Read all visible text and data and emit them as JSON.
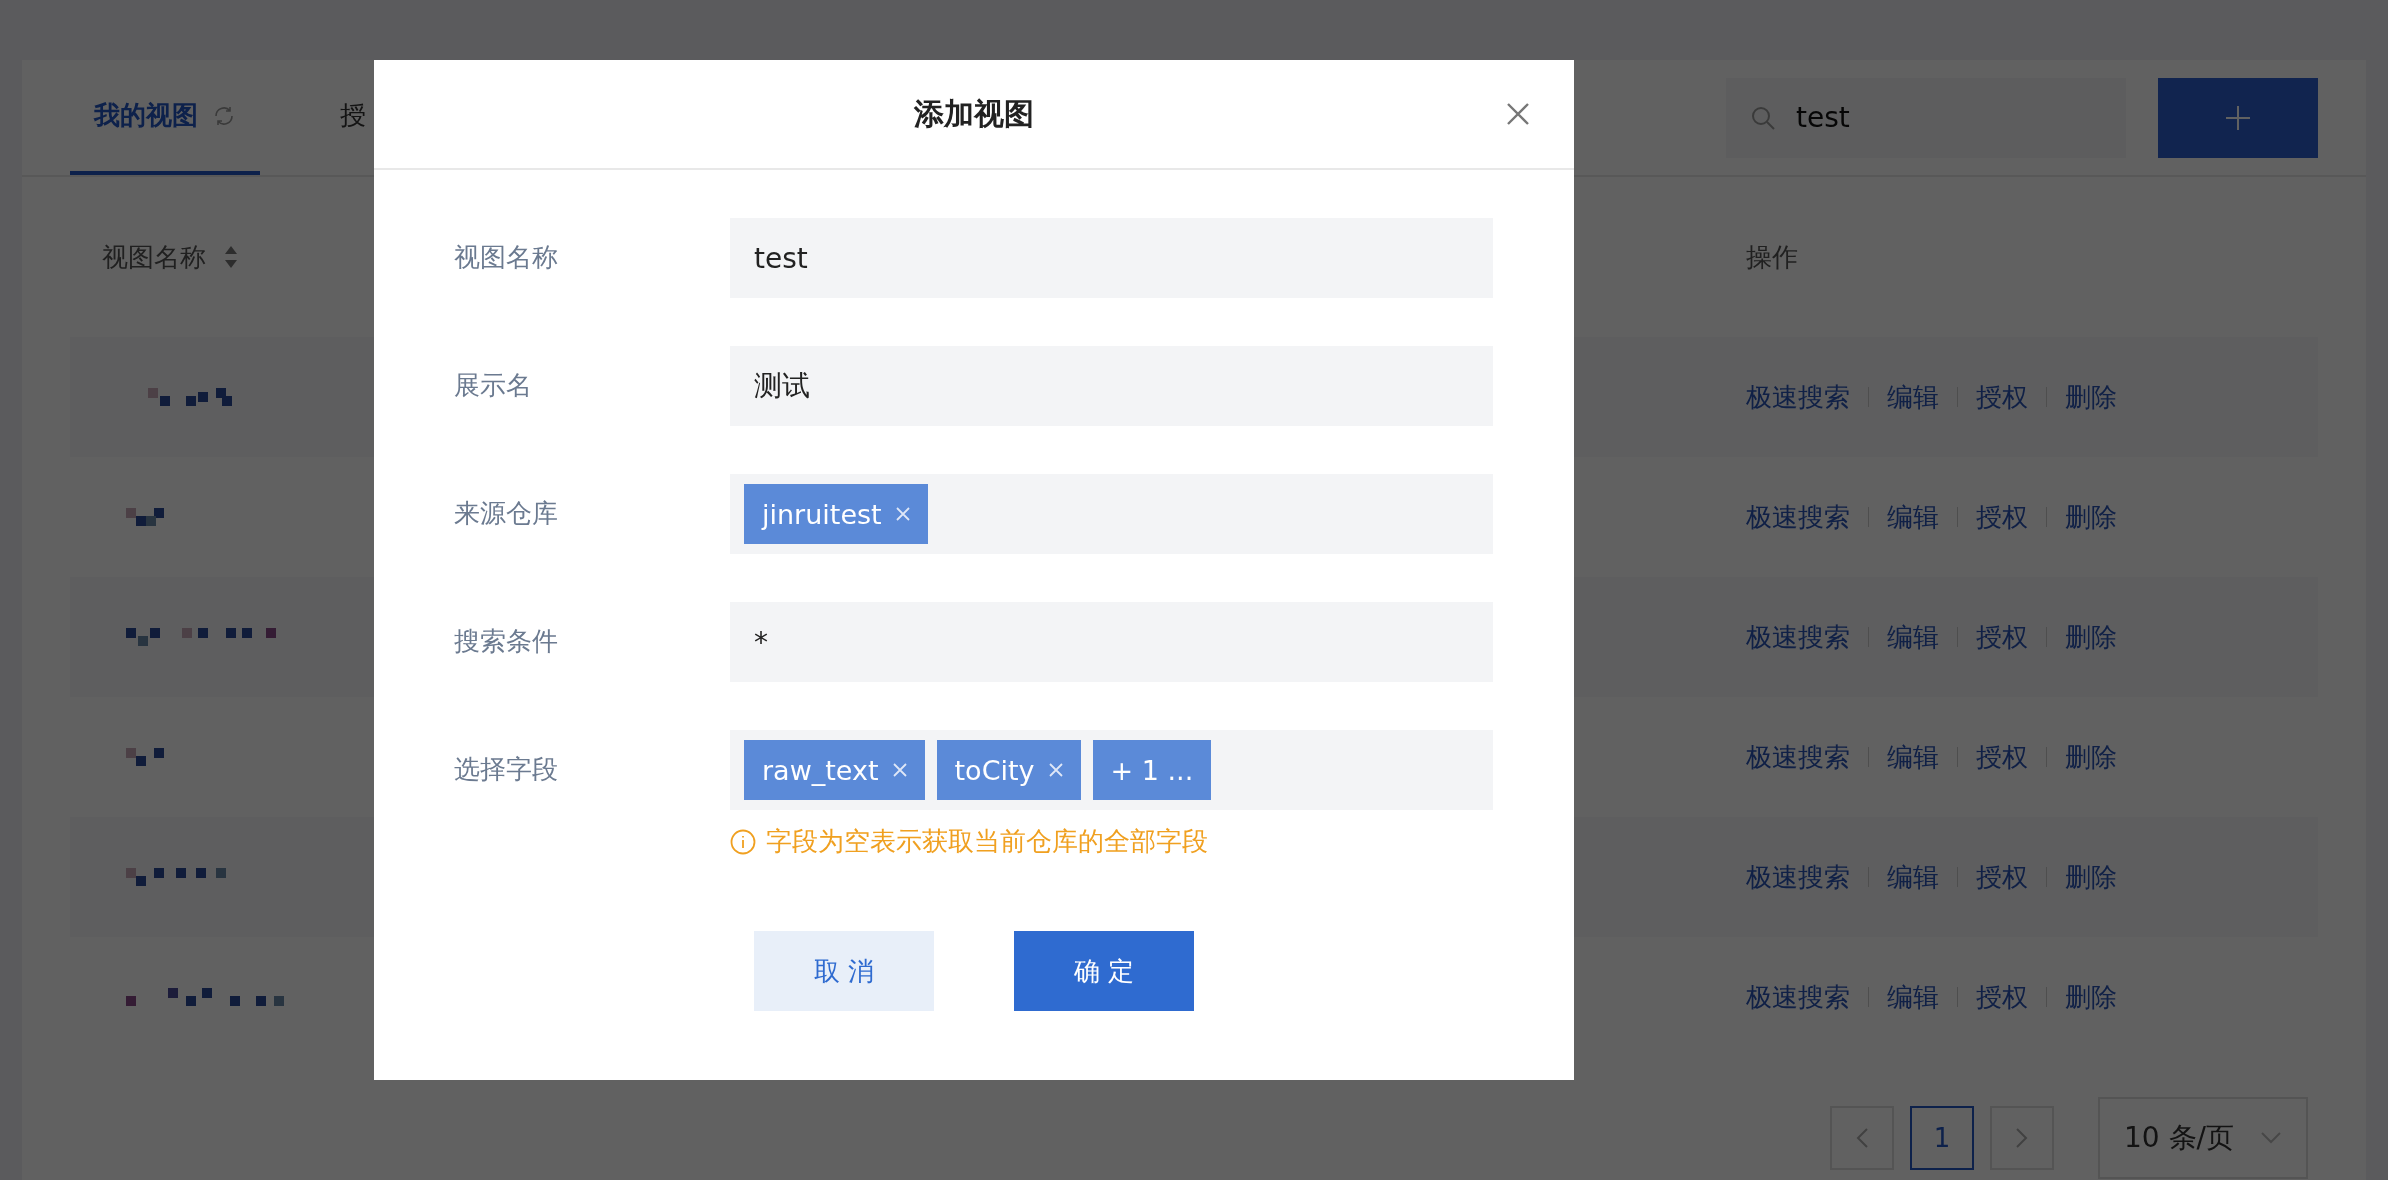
{
  "tabs": [
    {
      "label": "我的视图",
      "selected": true
    },
    {
      "label": "授",
      "selected": false
    }
  ],
  "search": {
    "value": "test"
  },
  "table": {
    "columns": [
      "视图名称",
      "操作"
    ],
    "rows": [
      {
        "actions": [
          "极速搜索",
          "编辑",
          "授权",
          "删除"
        ]
      },
      {
        "actions": [
          "极速搜索",
          "编辑",
          "授权",
          "删除"
        ]
      },
      {
        "actions": [
          "极速搜索",
          "编辑",
          "授权",
          "删除"
        ]
      },
      {
        "actions": [
          "极速搜索",
          "编辑",
          "授权",
          "删除"
        ]
      },
      {
        "actions": [
          "极速搜索",
          "编辑",
          "授权",
          "删除"
        ]
      },
      {
        "actions": [
          "极速搜索",
          "编辑",
          "授权",
          "删除"
        ]
      }
    ]
  },
  "pagination": {
    "pages": [
      {
        "label": "1",
        "selected": true
      }
    ],
    "page_size": "10 条/页"
  },
  "dialog": {
    "title": "添加视图",
    "fields": [
      {
        "kind": "text",
        "label": "视图名称",
        "value": "test"
      },
      {
        "kind": "text",
        "label": "展示名",
        "value": "测试"
      },
      {
        "kind": "tags",
        "label": "来源仓库",
        "tags": [
          {
            "label": "jinruitest",
            "removable": true
          }
        ]
      },
      {
        "kind": "text",
        "label": "搜索条件",
        "value": "*"
      },
      {
        "kind": "tags",
        "label": "选择字段",
        "tags": [
          {
            "label": "raw_text",
            "removable": true
          },
          {
            "label": "toCity",
            "removable": true
          },
          {
            "label": "+ 1 ...",
            "removable": false
          }
        ],
        "hint": "字段为空表示获取当前仓库的全部字段"
      }
    ],
    "buttons": [
      {
        "label": "取 消",
        "kind": "secondary"
      },
      {
        "label": "确 定",
        "kind": "primary"
      }
    ]
  }
}
